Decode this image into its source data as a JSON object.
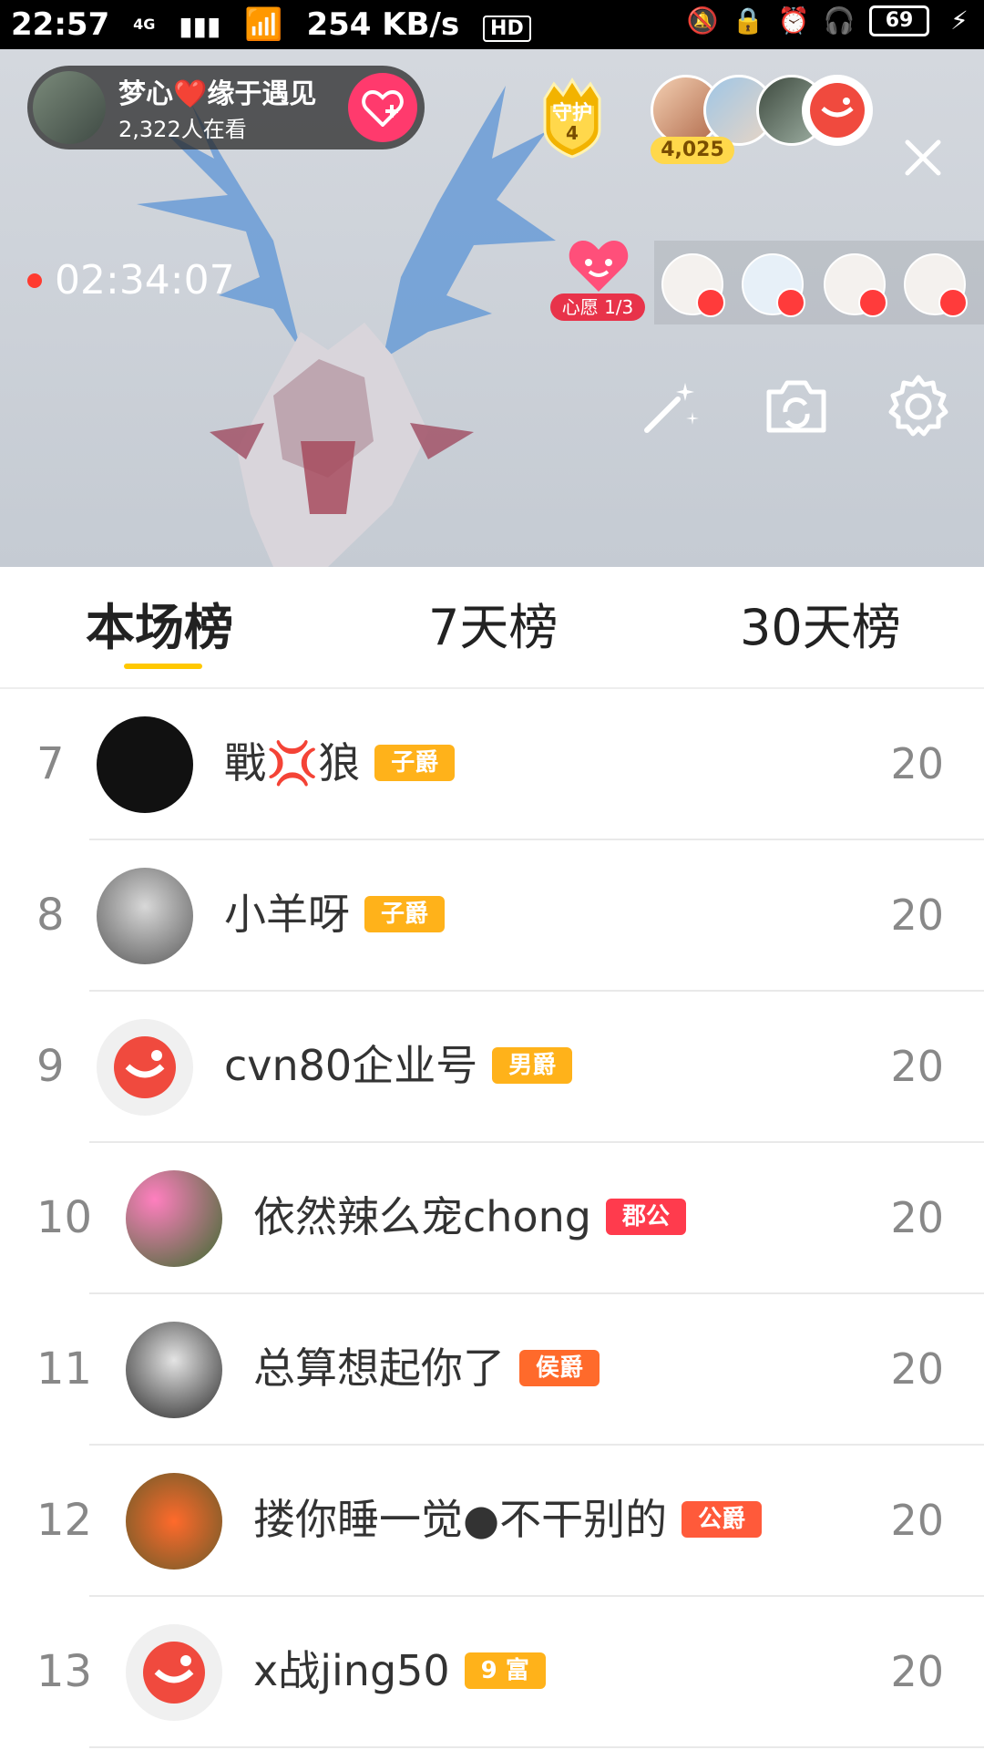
{
  "status_bar": {
    "time": "22:57",
    "network": "4G",
    "speed": "254 KB/s",
    "hd": "HD",
    "battery": "69"
  },
  "live": {
    "host_name": "梦心❤️缘于遇见",
    "viewers": "2,322人在看",
    "guard_label": "守护",
    "guard_count": "4",
    "coins": "4,025",
    "timer": "02:34:07",
    "wish_label": "心愿 1/3",
    "icons": [
      "magic-wand-icon",
      "camera-switch-icon",
      "gear-icon",
      "close-icon"
    ]
  },
  "tabs": [
    {
      "label": "本场榜",
      "active": true
    },
    {
      "label": "7天榜",
      "active": false
    },
    {
      "label": "30天榜",
      "active": false
    }
  ],
  "rankings": [
    {
      "rank": "7",
      "name": "戰💢狼",
      "badge": "子爵",
      "badge_color": "#ffb21a",
      "score": "20"
    },
    {
      "rank": "8",
      "name": "小羊呀",
      "badge": "子爵",
      "badge_color": "#ffb21a",
      "score": "20"
    },
    {
      "rank": "9",
      "name": "cvn80企业号",
      "badge": "男爵",
      "badge_color": "#ffb21a",
      "score": "20"
    },
    {
      "rank": "10",
      "name": "依然辣么宠chong",
      "badge": "郡公",
      "badge_color": "#ff3b4d",
      "score": "20"
    },
    {
      "rank": "11",
      "name": "总算想起你了",
      "badge": "侯爵",
      "badge_color": "#ff6a2b",
      "score": "20"
    },
    {
      "rank": "12",
      "name": "搂你睡一觉●不干别的",
      "badge": "公爵",
      "badge_color": "#ff5a3a",
      "score": "20"
    },
    {
      "rank": "13",
      "name": "x战jing50",
      "badge": "9 富",
      "badge_color": "#ffb21a",
      "score": "20"
    }
  ]
}
